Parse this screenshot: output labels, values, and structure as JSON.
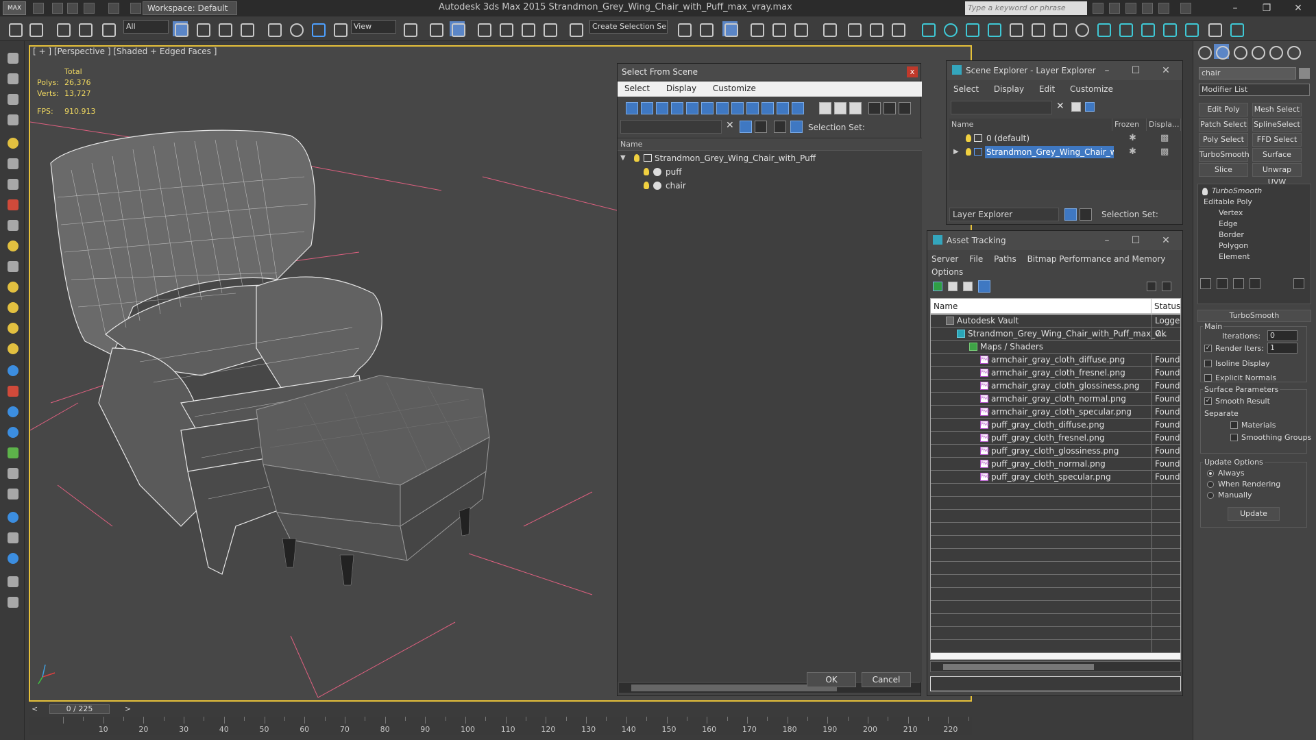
{
  "window": {
    "app_logo": "MAX",
    "workspace": "Workspace: Default",
    "title": "Autodesk 3ds Max  2015     Strandmon_Grey_Wing_Chair_with_Puff_max_vray.max",
    "search_placeholder": "Type a keyword or phrase"
  },
  "toolbar": {
    "filter_selected": "All",
    "view_selected": "View",
    "selection_set_selected": "Create Selection Se"
  },
  "viewport": {
    "label": "[ + ] [Perspective ] [Shaded + Edged Faces ]",
    "stats": {
      "total_label": "Total",
      "polys_label": "Polys:",
      "polys_value": "26,376",
      "verts_label": "Verts:",
      "verts_value": "13,727",
      "fps_label": "FPS:",
      "fps_value": "910.913"
    }
  },
  "select_from_scene": {
    "title": "Select From Scene",
    "close": "x",
    "menu": [
      "Select",
      "Display",
      "Customize"
    ],
    "selection_set_label": "Selection Set:",
    "column_name": "Name",
    "tree": {
      "root": "Strandmon_Grey_Wing_Chair_with_Puff",
      "children": [
        "puff",
        "chair"
      ]
    },
    "ok_label": "OK",
    "cancel_label": "Cancel"
  },
  "scene_explorer": {
    "title": "Scene Explorer - Layer Explorer",
    "menu": [
      "Select",
      "Display",
      "Edit",
      "Customize"
    ],
    "columns": [
      "Name",
      "Frozen",
      "Displa..."
    ],
    "layers": [
      "0 (default)",
      "Strandmon_Grey_Wing_Chair_with..."
    ],
    "explorer_selected": "Layer Explorer",
    "selection_set_label": "Selection Set:"
  },
  "asset_tracking": {
    "title": "Asset Tracking",
    "menu": [
      "Server",
      "File",
      "Paths",
      "Bitmap Performance and Memory",
      "Options"
    ],
    "columns": [
      "Name",
      "Status"
    ],
    "rows": [
      {
        "name": "Autodesk Vault",
        "status": "Logged"
      },
      {
        "name": "Strandmon_Grey_Wing_Chair_with_Puff_max_v...",
        "status": "Ok"
      },
      {
        "name": "Maps / Shaders",
        "status": ""
      },
      {
        "name": "armchair_gray_cloth_diffuse.png",
        "status": "Found"
      },
      {
        "name": "armchair_gray_cloth_fresnel.png",
        "status": "Found"
      },
      {
        "name": "armchair_gray_cloth_glossiness.png",
        "status": "Found"
      },
      {
        "name": "armchair_gray_cloth_normal.png",
        "status": "Found"
      },
      {
        "name": "armchair_gray_cloth_specular.png",
        "status": "Found"
      },
      {
        "name": "puff_gray_cloth_diffuse.png",
        "status": "Found"
      },
      {
        "name": "puff_gray_cloth_fresnel.png",
        "status": "Found"
      },
      {
        "name": "puff_gray_cloth_glossiness.png",
        "status": "Found"
      },
      {
        "name": "puff_gray_cloth_normal.png",
        "status": "Found"
      },
      {
        "name": "puff_gray_cloth_specular.png",
        "status": "Found"
      }
    ]
  },
  "command_panel": {
    "object_name": "chair",
    "modifier_list": "Modifier List",
    "buttons": [
      "Edit Poly",
      "Mesh Select",
      "Patch Select",
      "SplineSelect",
      "Poly Select",
      "FFD Select",
      "TurboSmooth",
      "Surface Select",
      "Slice",
      "Unwrap UVW"
    ],
    "stack": {
      "top": "TurboSmooth",
      "base": "Editable Poly",
      "subobjects": [
        "Vertex",
        "Edge",
        "Border",
        "Polygon",
        "Element"
      ]
    },
    "rollout_title": "TurboSmooth",
    "main_label": "Main",
    "iterations_label": "Iterations:",
    "iterations_value": "0",
    "render_iters_label": "Render Iters:",
    "render_iters_value": "1",
    "isoline_label": "Isoline Display",
    "explicit_normals_label": "Explicit Normals",
    "surface_params_label": "Surface Parameters",
    "smooth_result_label": "Smooth Result",
    "separate_label": "Separate",
    "materials_label": "Materials",
    "smoothing_groups_label": "Smoothing Groups",
    "update_options_label": "Update Options",
    "always_label": "Always",
    "when_rendering_label": "When Rendering",
    "manually_label": "Manually",
    "update_button": "Update"
  },
  "timeline": {
    "frame": "0 / 225",
    "ticks": [
      "10",
      "20",
      "30",
      "40",
      "50",
      "60",
      "70",
      "80",
      "90",
      "100",
      "110",
      "120",
      "130",
      "140",
      "150",
      "160",
      "170",
      "180",
      "190",
      "200",
      "210",
      "220"
    ]
  },
  "colors": {
    "viewport_border": "#e6c13a",
    "selection_highlight": "#3f78c2",
    "stats_text": "#f0d860",
    "grid_line": "#e06080"
  }
}
